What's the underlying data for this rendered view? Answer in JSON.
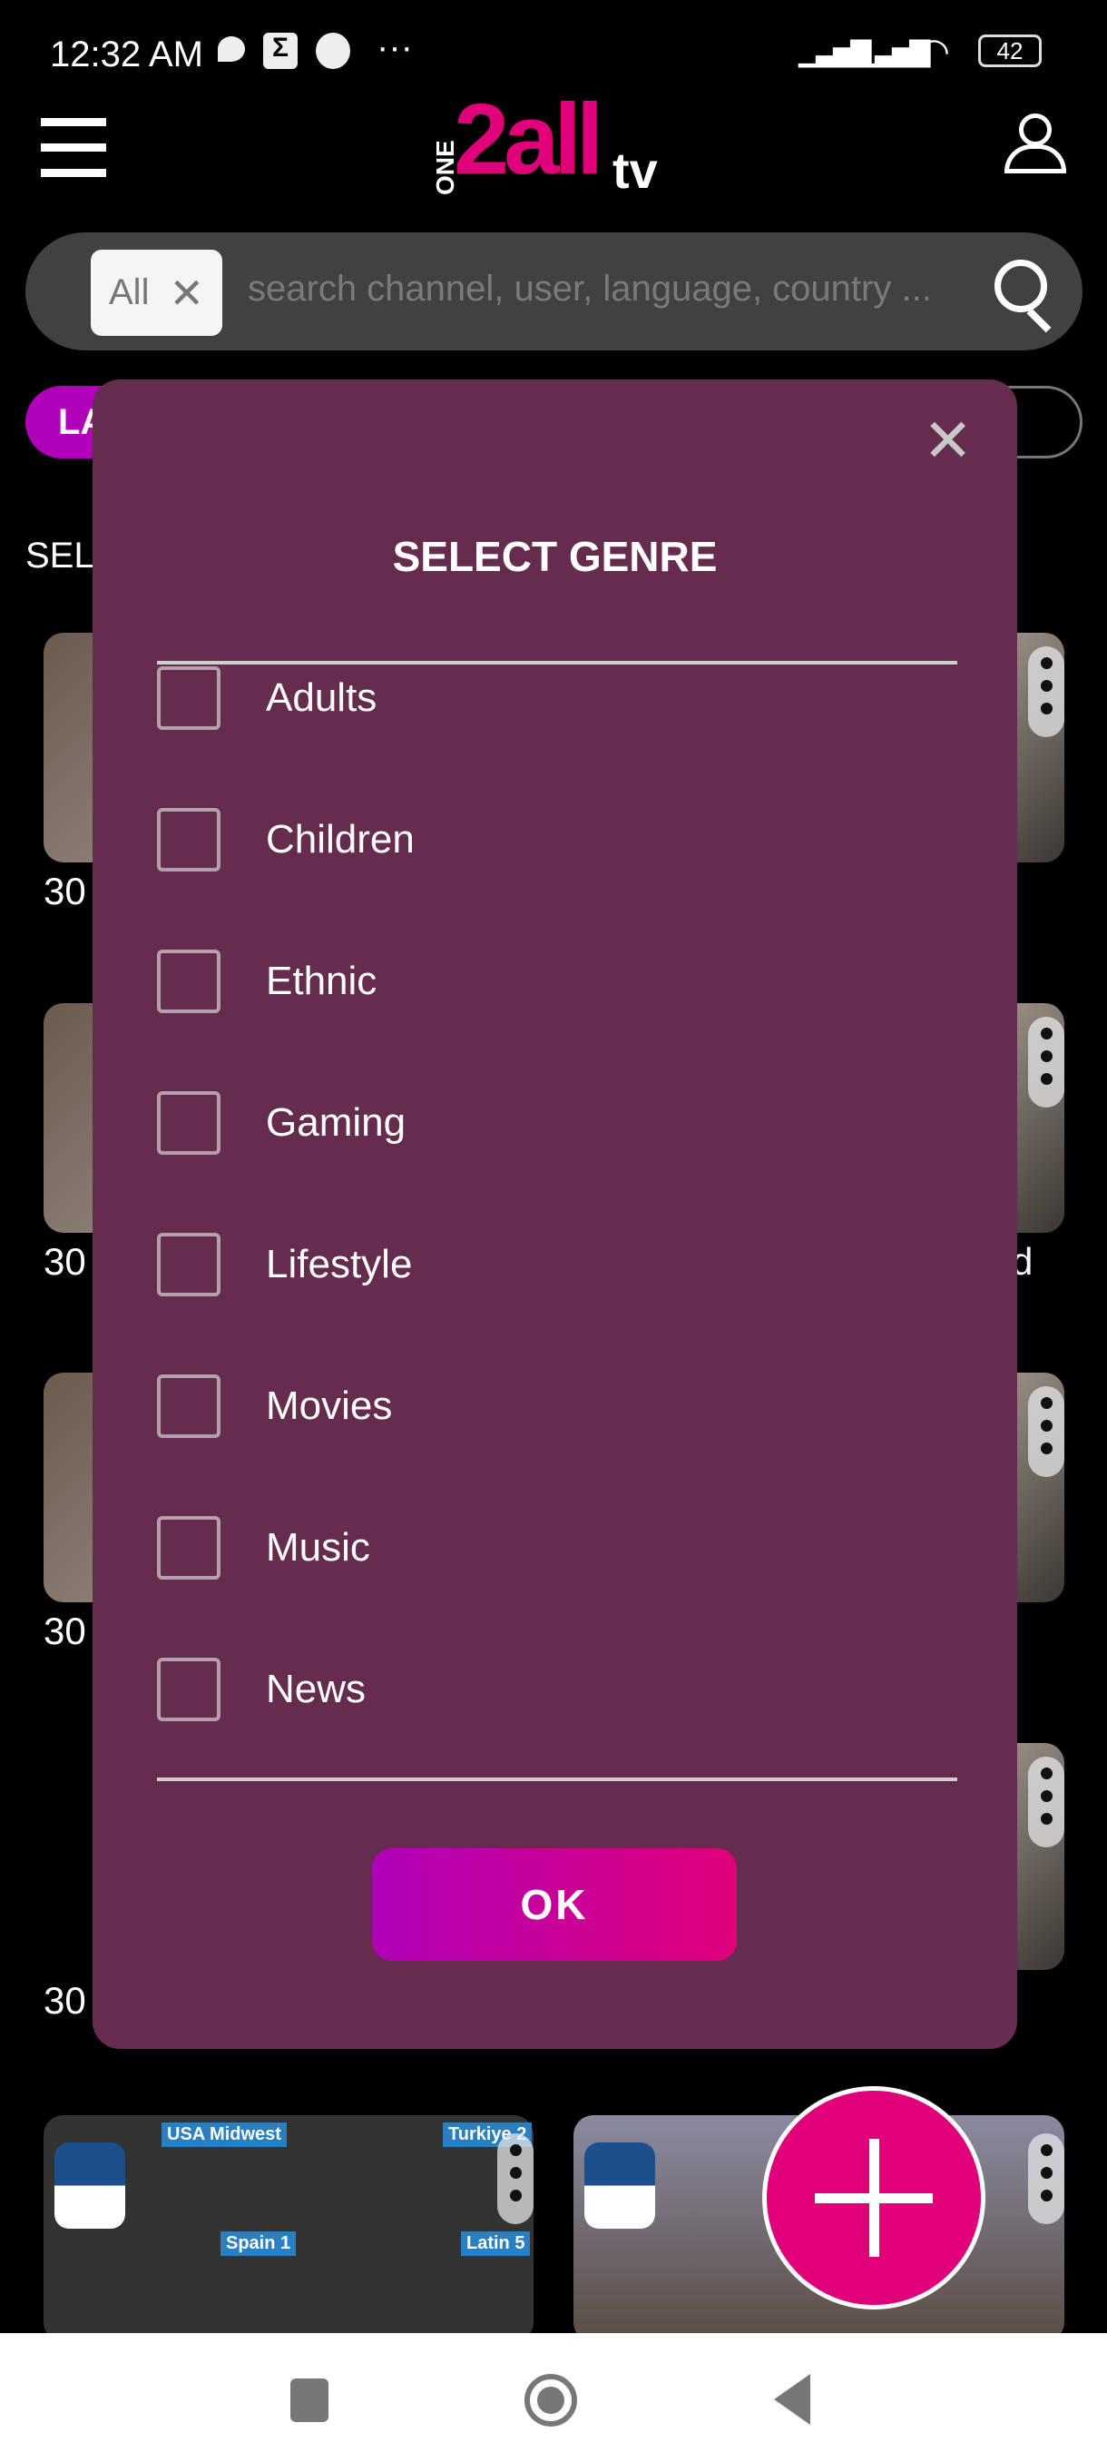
{
  "status_bar": {
    "time": "12:32 AM",
    "more": "···",
    "battery": "42"
  },
  "header": {
    "logo_text": "ONE2all.tv",
    "logo_one": "ONE",
    "logo_2all": "2all",
    "logo_tv": "tv"
  },
  "search": {
    "chip_label": "All",
    "placeholder": "search channel, user, language, country ..."
  },
  "filters": {
    "first_chip": "LA",
    "section_label": "SEL"
  },
  "cards": [
    {
      "label": "30"
    },
    {
      "label": "30"
    },
    {
      "label": "30"
    },
    {
      "label": "30"
    },
    {
      "label": "d"
    }
  ],
  "bottom_cards": {
    "tags": [
      "USA Midwest",
      "Turkiye 2",
      "Spain 1",
      "Latin 5"
    ]
  },
  "modal": {
    "title": "SELECT GENRE",
    "options": [
      {
        "label": "Adults",
        "checked": false
      },
      {
        "label": "Children",
        "checked": false
      },
      {
        "label": "Ethnic",
        "checked": false
      },
      {
        "label": "Gaming",
        "checked": false
      },
      {
        "label": "Lifestyle",
        "checked": false
      },
      {
        "label": "Movies",
        "checked": false
      },
      {
        "label": "Music",
        "checked": false
      },
      {
        "label": "News",
        "checked": false
      }
    ],
    "ok_label": "OK"
  },
  "colors": {
    "modal_bg": "#652c4e",
    "accent_pink": "#e0007a",
    "accent_purple": "#b000b8"
  }
}
